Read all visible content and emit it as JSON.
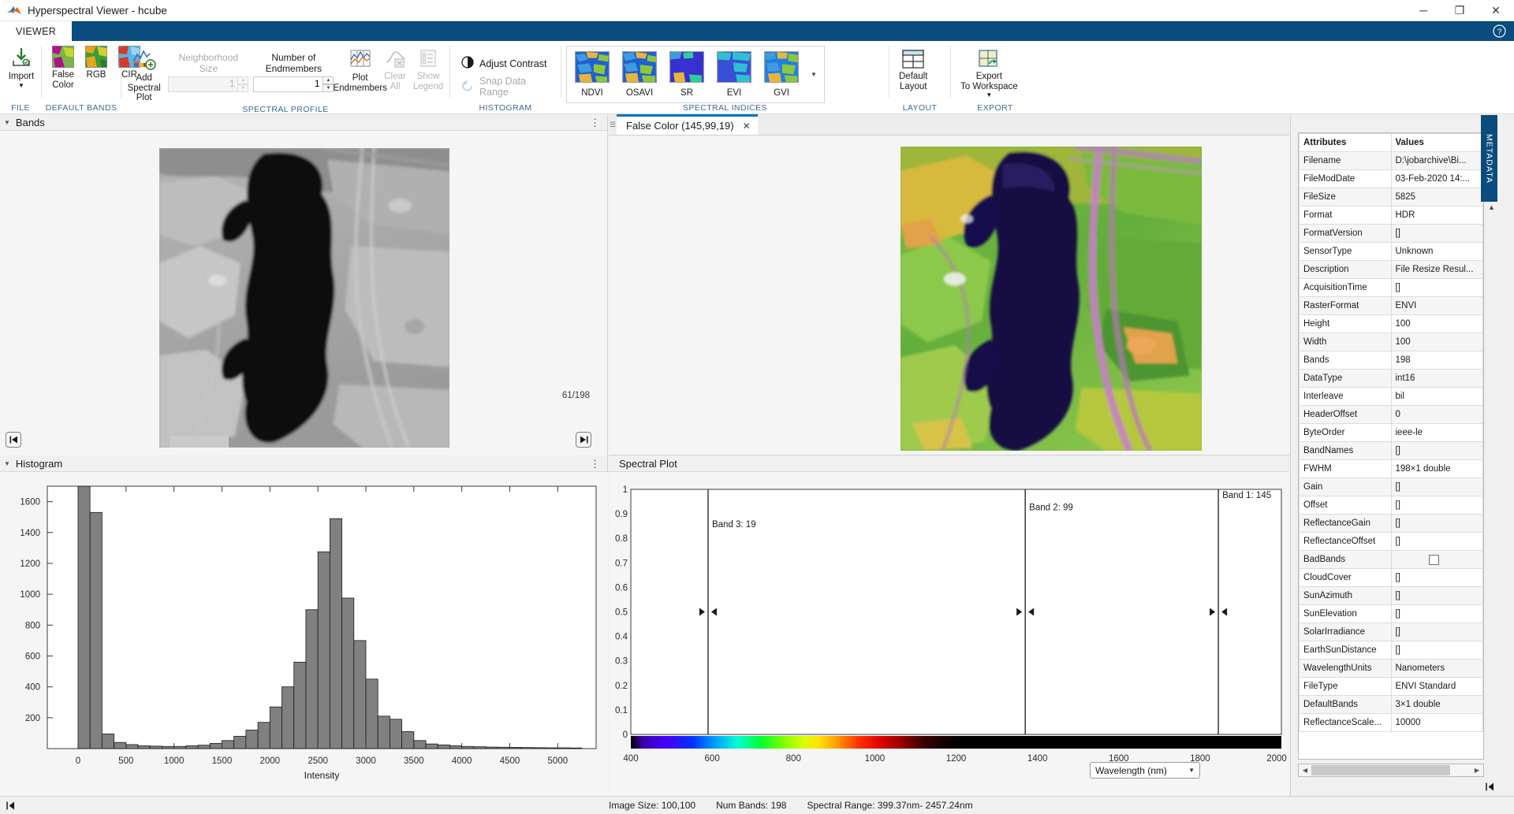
{
  "window": {
    "title": "Hyperspectral Viewer - hcube",
    "app_icon": "matlab-icon",
    "minimize": "─",
    "maximize": "❐",
    "close": "✕"
  },
  "ribbon": {
    "tabs": [
      {
        "label": "VIEWER"
      }
    ],
    "help_icon": "help-icon",
    "groups": [
      {
        "name": "FILE",
        "buttons": [
          {
            "label": "Import",
            "icon": "import-icon",
            "has_caret": true,
            "disabled": false
          }
        ]
      },
      {
        "name": "DEFAULT BANDS",
        "buttons": [
          {
            "label": "False\nColor",
            "icon": "false-color-icon",
            "disabled": false
          },
          {
            "label": "RGB",
            "icon": "rgb-icon",
            "disabled": false
          },
          {
            "label": "CIR",
            "icon": "cir-icon",
            "disabled": false
          }
        ]
      },
      {
        "name": "SPECTRAL PROFILE",
        "buttons": [
          {
            "label": "Add Spectral\nPlot",
            "icon": "add-spectral-plot-icon",
            "disabled": false
          },
          {
            "label": "Plot\nEndmembers",
            "icon": "plot-endmembers-icon",
            "disabled": false
          },
          {
            "label": "Clear\nAll",
            "icon": "clear-all-icon",
            "disabled": true
          },
          {
            "label": "Show\nLegend",
            "icon": "show-legend-icon",
            "disabled": true
          }
        ],
        "fields": [
          {
            "label": "Neighborhood Size",
            "value": "1",
            "disabled": true
          },
          {
            "label": "Number of Endmembers",
            "value": "1",
            "disabled": false
          }
        ]
      },
      {
        "name": "HISTOGRAM",
        "checks": [
          {
            "label": "Adjust Contrast",
            "icon": "contrast-icon",
            "disabled": false
          },
          {
            "label": "Snap Data Range",
            "icon": "snap-icon",
            "disabled": true
          }
        ]
      },
      {
        "name": "SPECTRAL INDICES",
        "indices": [
          {
            "label": "NDVI",
            "icon": "index-thumb-ndvi"
          },
          {
            "label": "OSAVI",
            "icon": "index-thumb-osavi"
          },
          {
            "label": "SR",
            "icon": "index-thumb-sr"
          },
          {
            "label": "EVI",
            "icon": "index-thumb-evi"
          },
          {
            "label": "GVI",
            "icon": "index-thumb-gvi"
          }
        ],
        "overflow_caret": "▼"
      },
      {
        "name": "LAYOUT",
        "buttons": [
          {
            "label": "Default\nLayout",
            "icon": "default-layout-icon",
            "disabled": false
          }
        ]
      },
      {
        "name": "EXPORT",
        "buttons": [
          {
            "label": "Export\nTo Workspace",
            "icon": "export-workspace-icon",
            "has_caret": true,
            "disabled": false
          }
        ]
      }
    ]
  },
  "bands_panel": {
    "title": "Bands",
    "counter": "61/198",
    "prev_icon": "skip-to-start-icon",
    "next_icon": "skip-to-end-icon",
    "kebab": "⋮"
  },
  "viewer_panel": {
    "tab_label": "False Color (145,99,19)",
    "close_icon": "close-icon",
    "grip_icon": "drag-grip-icon"
  },
  "histogram_panel": {
    "title": "Histogram",
    "kebab": "⋮"
  },
  "spectral_panel": {
    "title": "Spectral Plot",
    "wavelength_select": "Wavelength (nm)",
    "wavelength_caret": "▼"
  },
  "metadata_panel": {
    "side_tab": "METADATA",
    "columns": [
      "Attributes",
      "Values"
    ],
    "rows": [
      [
        "Filename",
        "D:\\jobarchive\\Bi..."
      ],
      [
        "FileModDate",
        "03-Feb-2020 14:..."
      ],
      [
        "FileSize",
        "5825"
      ],
      [
        "Format",
        "HDR"
      ],
      [
        "FormatVersion",
        "[]"
      ],
      [
        "SensorType",
        "Unknown"
      ],
      [
        "Description",
        "File Resize Resul..."
      ],
      [
        "AcquisitionTime",
        "[]"
      ],
      [
        "RasterFormat",
        "ENVI"
      ],
      [
        "Height",
        "100"
      ],
      [
        "Width",
        "100"
      ],
      [
        "Bands",
        "198"
      ],
      [
        "DataType",
        "int16"
      ],
      [
        "Interleave",
        "bil"
      ],
      [
        "HeaderOffset",
        "0"
      ],
      [
        "ByteOrder",
        "ieee-le"
      ],
      [
        "BandNames",
        "[]"
      ],
      [
        "FWHM",
        "198×1 double"
      ],
      [
        "Gain",
        "[]"
      ],
      [
        "Offset",
        "[]"
      ],
      [
        "ReflectanceGain",
        "[]"
      ],
      [
        "ReflectanceOffset",
        "[]"
      ],
      [
        "BadBands",
        "__CHECKBOX__"
      ],
      [
        "CloudCover",
        "[]"
      ],
      [
        "SunAzimuth",
        "[]"
      ],
      [
        "SunElevation",
        "[]"
      ],
      [
        "SolarIrradiance",
        "[]"
      ],
      [
        "EarthSunDistance",
        "[]"
      ],
      [
        "WavelengthUnits",
        "Nanometers"
      ],
      [
        "FileType",
        "ENVI Standard"
      ],
      [
        "DefaultBands",
        "3×1 double"
      ],
      [
        "ReflectanceScale...",
        "10000"
      ]
    ]
  },
  "statusbar": {
    "image_size": "Image Size: 100,100",
    "num_bands": "Num Bands: 198",
    "spectral_range": "Spectral Range: 399.37nm- 2457.24nm"
  },
  "chart_data": [
    {
      "type": "bar",
      "title": "Histogram",
      "xlabel": "Intensity",
      "ylabel": "",
      "xlim": [
        -320,
        5400
      ],
      "ylim": [
        0,
        1700
      ],
      "xticks": [
        0,
        500,
        1000,
        1500,
        2000,
        2500,
        3000,
        3500,
        4000,
        4500,
        5000
      ],
      "yticks": [
        0,
        200,
        400,
        600,
        800,
        1000,
        1200,
        1400,
        1600
      ],
      "grid": false,
      "bar_color": "#808080",
      "bin_width": 125,
      "bin_starts": [
        0,
        125,
        250,
        375,
        500,
        625,
        750,
        875,
        1000,
        1125,
        1250,
        1375,
        1500,
        1625,
        1750,
        1875,
        2000,
        2125,
        2250,
        2375,
        2500,
        2625,
        2750,
        2875,
        3000,
        3125,
        3250,
        3375,
        3500,
        3625,
        3750,
        3875,
        4000,
        4125,
        4250,
        4375,
        4500,
        4625,
        4750,
        4875,
        5000,
        5125
      ],
      "values": [
        1720,
        1530,
        95,
        40,
        26,
        18,
        16,
        14,
        14,
        18,
        22,
        34,
        52,
        80,
        120,
        170,
        270,
        400,
        560,
        900,
        1275,
        1490,
        975,
        700,
        450,
        210,
        190,
        110,
        52,
        30,
        24,
        18,
        14,
        12,
        10,
        9,
        8,
        7,
        6,
        5,
        5,
        4
      ]
    },
    {
      "type": "line",
      "title": "Spectral Plot",
      "xlabel": "Wavelength (nm)",
      "ylabel": "",
      "xlim": [
        400,
        2000
      ],
      "ylim": [
        0,
        1
      ],
      "xticks": [
        400,
        600,
        800,
        1000,
        1200,
        1400,
        1600,
        1800,
        2000
      ],
      "yticks": [
        0,
        0.1,
        0.2,
        0.3,
        0.4,
        0.5,
        0.6,
        0.7,
        0.8,
        0.9,
        1
      ],
      "grid": false,
      "band_markers": [
        {
          "label": "Band 3: 19",
          "wavelength": 590,
          "handle_y": 0.5
        },
        {
          "label": "Band 2: 99",
          "wavelength": 1370,
          "handle_y": 0.5
        },
        {
          "label": "Band 1: 145",
          "wavelength": 1845,
          "handle_y": 0.5
        }
      ],
      "colorbar": "visible-to-nir-spectrum"
    }
  ]
}
